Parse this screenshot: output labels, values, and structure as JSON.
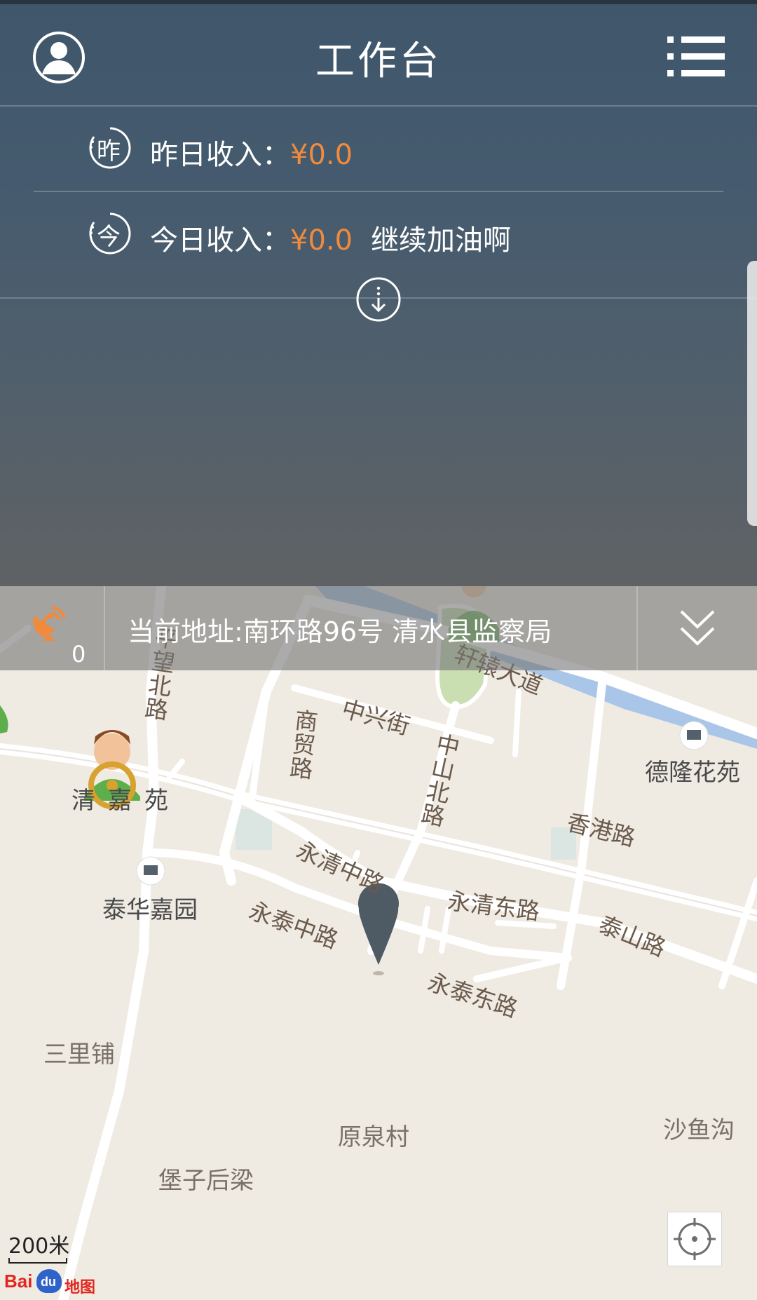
{
  "header": {
    "title": "工作台"
  },
  "income": {
    "yesterday_badge": "昨",
    "yesterday_label": "昨日收入：",
    "yesterday_amount": "¥0.0",
    "today_badge": "今",
    "today_label": "今日收入：",
    "today_amount": "¥0.0",
    "today_note": "继续加油啊"
  },
  "address_bar": {
    "gps_count": "0",
    "address": "当前地址:南环路96号  清水县监察局"
  },
  "map": {
    "roads": {
      "xuanyuan": "轩辕大道",
      "zhongxing": "中兴街",
      "shangmao": "商贸路",
      "zhongshan_bei": "中山北路",
      "pingwang_bei": "平望北路",
      "xianggang": "香港路",
      "yongqing_zhong": "永清中路",
      "yongqing_dong": "永清东路",
      "taishan": "泰山路",
      "yongtai_zhong": "永泰中路",
      "yongtai_dong": "永泰东路"
    },
    "places": {
      "delong": "德隆花苑",
      "qingjia": "清嘉苑",
      "taihua": "泰华嘉园",
      "sanlipu": "三里铺",
      "yuanquan": "原泉村",
      "shayu": "沙鱼沟",
      "baozi": "堡子后梁"
    },
    "scale": "200米",
    "logo_text": "Bai",
    "logo_du": "du",
    "logo_map": "地图"
  },
  "colors": {
    "accent": "#f08a3c",
    "header_bg": "#3f566b",
    "marker": "#4e5a64",
    "river": "#a9c6e8",
    "park": "#c9dfb2"
  },
  "icons": {
    "avatar": "user-avatar-icon",
    "menu": "list-menu-icon",
    "expand": "expand-down-icon",
    "gps": "satellite-dish-icon",
    "collapse": "double-chevron-down-icon",
    "locate": "locate-crosshair-icon",
    "pin": "map-pin-icon",
    "driver": "driver-avatar-icon"
  }
}
